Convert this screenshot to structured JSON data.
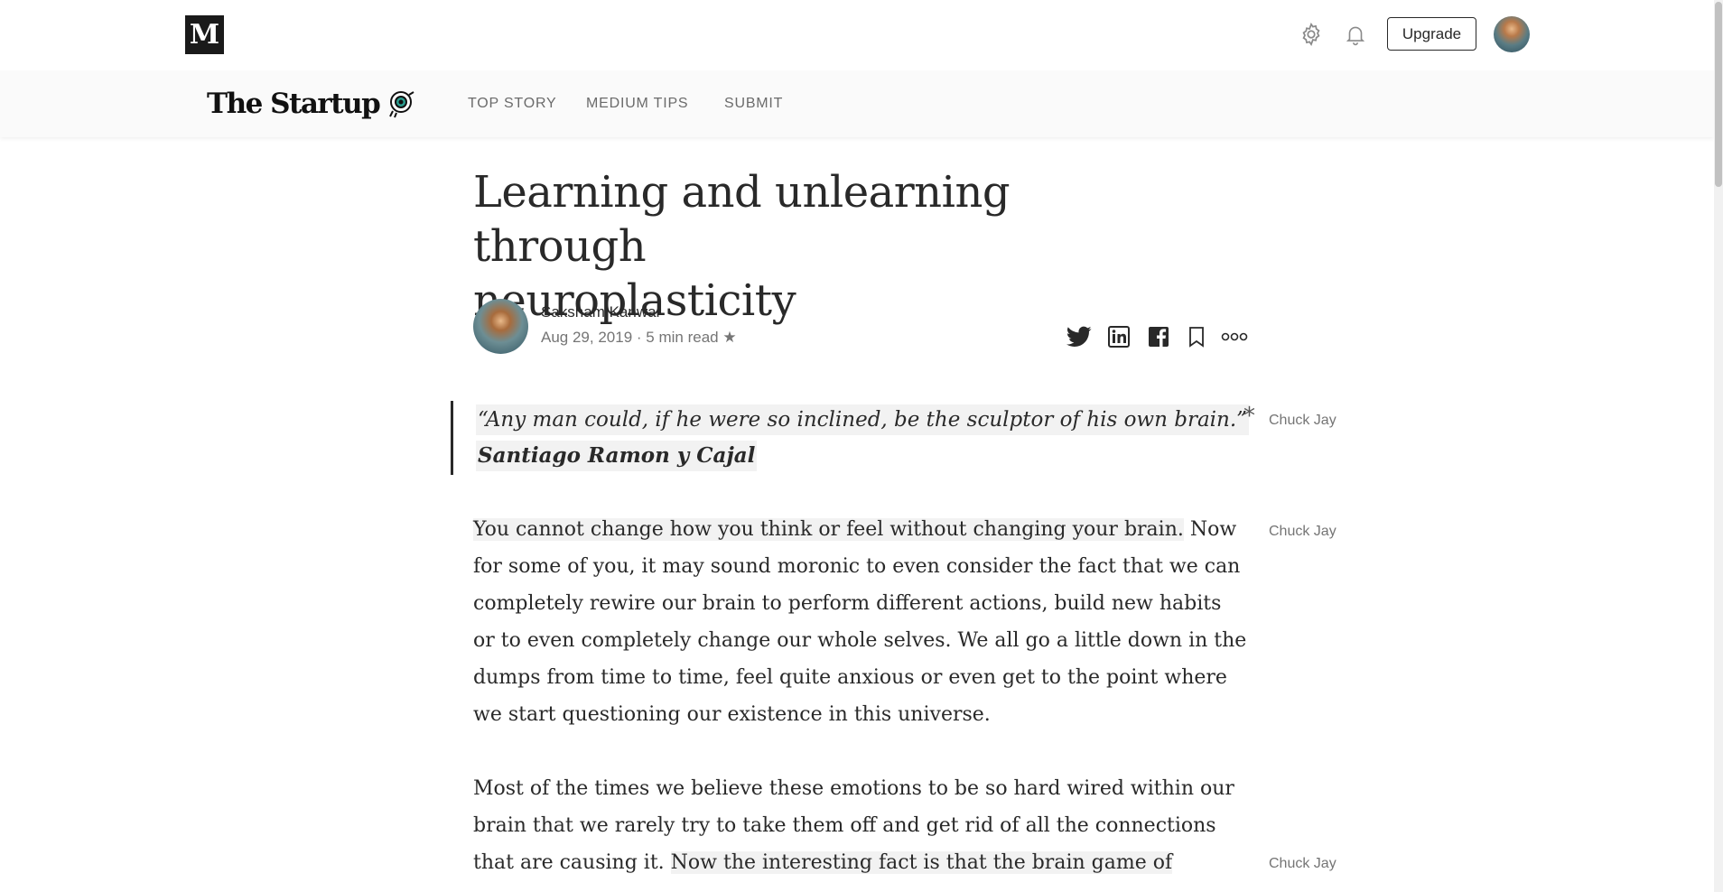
{
  "header": {
    "logo_letter": "M",
    "upgrade_label": "Upgrade",
    "icons": [
      "settings-icon",
      "bell-icon"
    ]
  },
  "publication": {
    "name": "The Startup",
    "nav": [
      "TOP STORY",
      "MEDIUM TIPS",
      "SUBMIT"
    ]
  },
  "article": {
    "title_line1": "Learning and unlearning through",
    "title_line2": "neuroplasticity",
    "author": "Saksham Kanwar",
    "date": "Aug 29, 2019",
    "separator": "·",
    "read_time": "5 min read",
    "member_star": "★",
    "share_icons": [
      "twitter-icon",
      "linkedin-icon",
      "facebook-icon",
      "bookmark-icon",
      "more-icon"
    ],
    "quote": {
      "text": "“Any man could, if he were so inclined, be the sculptor of his own brain.”",
      "attribution": "Santiago Ramon y Cajal",
      "top_highlight_mark": "*"
    },
    "paragraph1": {
      "line1_highlight": "You cannot change how you think or feel without changing your brain.",
      "line1_rest": " Now",
      "line2": "for some of you, it may sound moronic to even consider the fact that we can",
      "line3": "completely rewire our brain to perform different actions, build new habits",
      "line4": "or to even completely change our whole selves. We all go a little down in the",
      "line5": "dumps from time to time, feel quite anxious or even get to the point where",
      "line6": "we start questioning our existence in this universe."
    },
    "paragraph2": {
      "line1": "Most of the times we believe these emotions to be so hard wired within our",
      "line2": "brain that we rarely try to take them off and get rid of all the connections",
      "line3_plain": "that are causing it. ",
      "line3_highlight": "Now the interesting fact is that the brain game of"
    },
    "highlighters": {
      "quote": "Chuck Jay",
      "para1": "Chuck Jay",
      "para2": "Chuck Jay"
    }
  }
}
